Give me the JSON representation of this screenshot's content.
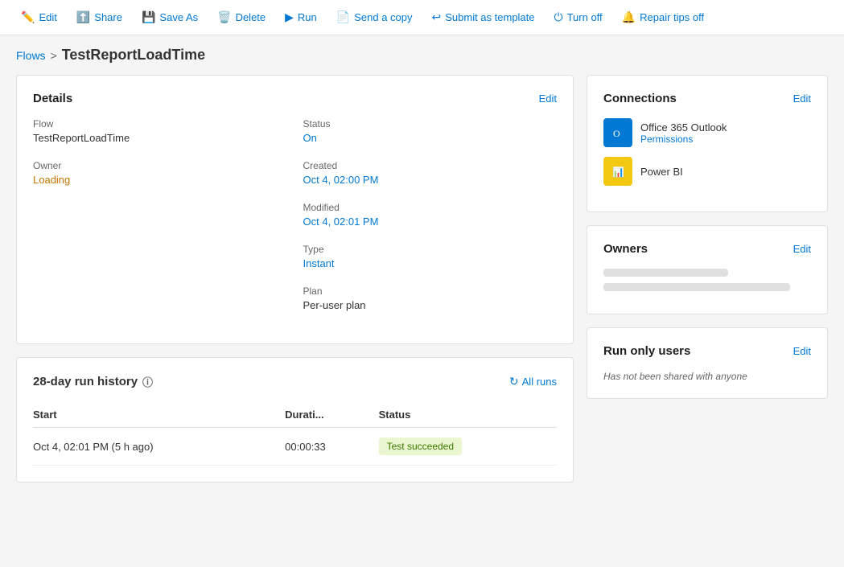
{
  "toolbar": {
    "buttons": [
      {
        "id": "edit",
        "label": "Edit",
        "icon": "✏️"
      },
      {
        "id": "share",
        "label": "Share",
        "icon": "⬆️"
      },
      {
        "id": "save-as",
        "label": "Save As",
        "icon": "💾"
      },
      {
        "id": "delete",
        "label": "Delete",
        "icon": "🗑️"
      },
      {
        "id": "run",
        "label": "Run",
        "icon": "▶"
      },
      {
        "id": "send-copy",
        "label": "Send a copy",
        "icon": "📄"
      },
      {
        "id": "submit-template",
        "label": "Submit as template",
        "icon": "↩"
      },
      {
        "id": "turn-off",
        "label": "Turn off",
        "icon": "⏻"
      },
      {
        "id": "repair-tips",
        "label": "Repair tips off",
        "icon": "🔔"
      }
    ]
  },
  "breadcrumb": {
    "parent": "Flows",
    "separator": ">",
    "current": "TestReportLoadTime"
  },
  "details_card": {
    "title": "Details",
    "edit_label": "Edit",
    "flow_label": "Flow",
    "flow_value": "TestReportLoadTime",
    "owner_label": "Owner",
    "owner_value": "Loading",
    "status_label": "Status",
    "status_value": "On",
    "created_label": "Created",
    "created_value": "Oct 4, 02:00 PM",
    "modified_label": "Modified",
    "modified_value": "Oct 4, 02:01 PM",
    "type_label": "Type",
    "type_value": "Instant",
    "plan_label": "Plan",
    "plan_value": "Per-user plan"
  },
  "run_history": {
    "title": "28-day run history",
    "all_runs_label": "All runs",
    "start_col": "Start",
    "duration_col": "Durati...",
    "status_col": "Status",
    "rows": [
      {
        "start": "Oct 4, 02:01 PM (5 h ago)",
        "duration": "00:00:33",
        "status": "Test succeeded"
      }
    ]
  },
  "connections_card": {
    "title": "Connections",
    "edit_label": "Edit",
    "items": [
      {
        "name": "Office 365 Outlook",
        "link": "Permissions",
        "icon_type": "outlook"
      },
      {
        "name": "Power BI",
        "link": "",
        "icon_type": "powerbi"
      }
    ]
  },
  "owners_card": {
    "title": "Owners",
    "edit_label": "Edit"
  },
  "run_only_card": {
    "title": "Run only users",
    "edit_label": "Edit",
    "no_share_text": "Has not been shared with anyone"
  }
}
